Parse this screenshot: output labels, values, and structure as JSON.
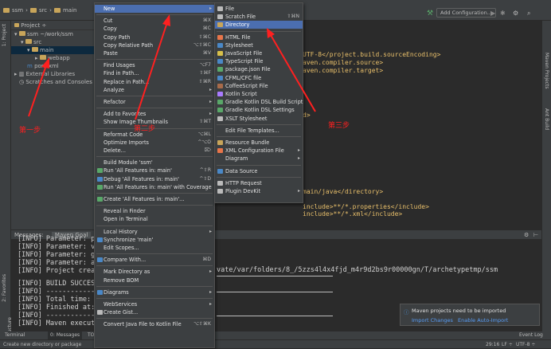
{
  "breadcrumb": [
    "ssm",
    "src",
    "main"
  ],
  "toolbar": {
    "add_config": "Add Configuration..."
  },
  "left_strip": [
    "1: Project",
    "2: Favorites",
    "2: Structure"
  ],
  "right_strip": [
    "Maven Projects",
    "Ant Build"
  ],
  "project_panel": {
    "header": "Project",
    "items": [
      {
        "label": "ssm ~/work/ssm",
        "indent": 0
      },
      {
        "label": "src",
        "indent": 1
      },
      {
        "label": "main",
        "indent": 2,
        "selected": true
      },
      {
        "label": "webapp",
        "indent": 3
      },
      {
        "label": "pom.xml",
        "indent": 1
      },
      {
        "label": "External Libraries",
        "indent": 0
      },
      {
        "label": "Scratches and Consoles",
        "indent": 0
      }
    ]
  },
  "editor_lines": [
    "UTF-8</project.build.sourceEncoding>",
    "aven.compiler.source>",
    "aven.compiler.target>",
    "d>",
    "main/java</directory>",
    "include>**/*.properties</include>",
    "include>**/*.xml</include>"
  ],
  "messages": {
    "tab1": "Messages:",
    "tab2": "Maven Goal"
  },
  "console_lines": [
    "[INFO] Parameter: pa",
    "[INFO] Parameter: ve",
    "[INFO] Parameter: gr",
    "[INFO] Parameter: ar",
    "[INFO] Project creat",
    "[INFO] BUILD SUCCESS",
    "[INFO] ------------",
    "[INFO] Total time: 4",
    "[INFO] Finished at:",
    "[INFO] ------------",
    "[INFO] Maven executi"
  ],
  "console_right": [
    "vate/var/folders/8_/5zzs4l4x4fjd_m4r9d2bs9r00000gn/T/archetypetmp/ssm"
  ],
  "bottom_tabs": {
    "terminal": "Terminal",
    "messages": "0: Messages",
    "todo": "TODO",
    "event_log": "Event Log"
  },
  "status": {
    "left": "Create new directory or package",
    "pos": "29:16",
    "lf": "LF ÷",
    "enc": "UTF-8 ÷"
  },
  "notification": {
    "title": "Maven projects need to be imported",
    "import": "Import Changes",
    "auto": "Enable Auto-Import"
  },
  "context_menu": [
    {
      "label": "New",
      "hl": true,
      "sub": true
    },
    {
      "sep": true
    },
    {
      "label": "Cut",
      "sc": "⌘X"
    },
    {
      "label": "Copy",
      "sc": "⌘C"
    },
    {
      "label": "Copy Path",
      "sc": "⇧⌘C"
    },
    {
      "label": "Copy Relative Path",
      "sc": "⌥⇧⌘C"
    },
    {
      "label": "Paste",
      "sc": "⌘V"
    },
    {
      "sep": true
    },
    {
      "label": "Find Usages",
      "sc": "⌥F7"
    },
    {
      "label": "Find in Path...",
      "sc": "⇧⌘F"
    },
    {
      "label": "Replace in Path...",
      "sc": "⇧⌘R"
    },
    {
      "label": "Analyze",
      "sub": true
    },
    {
      "sep": true
    },
    {
      "label": "Refactor",
      "sub": true
    },
    {
      "sep": true
    },
    {
      "label": "Add to Favorites",
      "sub": true
    },
    {
      "label": "Show Image Thumbnails",
      "sc": "⇧⌘T"
    },
    {
      "sep": true
    },
    {
      "label": "Reformat Code",
      "sc": "⌥⌘L"
    },
    {
      "label": "Optimize Imports",
      "sc": "^⌥O"
    },
    {
      "label": "Delete...",
      "sc": "⌦"
    },
    {
      "sep": true
    },
    {
      "label": "Build Module 'ssm'"
    },
    {
      "label": "Run 'All Features in: main'",
      "sc": "^⇧R",
      "icon": "#59a869"
    },
    {
      "label": "Debug 'All Features in: main'",
      "sc": "^⇧D",
      "icon": "#4a88c7"
    },
    {
      "label": "Run 'All Features in: main' with Coverage",
      "icon": "#59a869"
    },
    {
      "sep": true
    },
    {
      "label": "Create 'All Features in: main'...",
      "icon": "#59a869"
    },
    {
      "sep": true
    },
    {
      "label": "Reveal in Finder"
    },
    {
      "label": "Open in Terminal"
    },
    {
      "sep": true
    },
    {
      "label": "Local History",
      "sub": true
    },
    {
      "label": "Synchronize 'main'",
      "icon": "#4a88c7"
    },
    {
      "label": "Edit Scopes..."
    },
    {
      "sep": true
    },
    {
      "label": "Compare With...",
      "sc": "⌘D",
      "icon": "#4a88c7"
    },
    {
      "sep": true
    },
    {
      "label": "Mark Directory as",
      "sub": true
    },
    {
      "label": "Remove BOM"
    },
    {
      "sep": true
    },
    {
      "label": "Diagrams",
      "sub": true,
      "icon": "#4a88c7"
    },
    {
      "sep": true
    },
    {
      "label": "WebServices",
      "sub": true
    },
    {
      "label": "Create Gist...",
      "icon": "#bbbbbb"
    },
    {
      "sep": true
    },
    {
      "label": "Convert Java File to Kotlin File",
      "sc": "⌥⇧⌘K"
    }
  ],
  "submenu": [
    {
      "label": "File",
      "icon": "#bbbbbb"
    },
    {
      "label": "Scratch File",
      "sc": "⇧⌘N",
      "icon": "#bbbbbb"
    },
    {
      "label": "Directory",
      "hl": true,
      "icon": "#c8a55a"
    },
    {
      "sep": true
    },
    {
      "label": "HTML File",
      "icon": "#e8754a"
    },
    {
      "label": "Stylesheet",
      "icon": "#4a88c7"
    },
    {
      "label": "JavaScript File",
      "icon": "#d8c04a"
    },
    {
      "label": "TypeScript File",
      "icon": "#4a88c7"
    },
    {
      "label": "package.json File",
      "icon": "#59a869"
    },
    {
      "label": "CFML/CFC file",
      "icon": "#4a88c7"
    },
    {
      "label": "CoffeeScript File",
      "icon": "#a86b4a"
    },
    {
      "label": "Kotlin Script",
      "icon": "#a97bff"
    },
    {
      "label": "Gradle Kotlin DSL Build Script",
      "icon": "#59a869"
    },
    {
      "label": "Gradle Kotlin DSL Settings",
      "icon": "#59a869"
    },
    {
      "label": "XSLT Stylesheet",
      "icon": "#bbbbbb"
    },
    {
      "sep": true
    },
    {
      "label": "Edit File Templates..."
    },
    {
      "sep": true
    },
    {
      "label": "Resource Bundle",
      "icon": "#c8a55a"
    },
    {
      "label": "XML Configuration File",
      "sub": true,
      "icon": "#e8754a"
    },
    {
      "label": "Diagram",
      "sub": true
    },
    {
      "sep": true
    },
    {
      "label": "Data Source",
      "icon": "#4a88c7"
    },
    {
      "sep": true
    },
    {
      "label": "HTTP Request",
      "icon": "#bbbbbb"
    },
    {
      "label": "Plugin DevKit",
      "sub": true,
      "icon": "#bbbbbb"
    }
  ],
  "annotations": {
    "step1": "第一步",
    "step2": "第二步",
    "step3": "第三步"
  },
  "colors": {
    "accent": "#4b6eaf",
    "arrow": "#ff2020"
  }
}
